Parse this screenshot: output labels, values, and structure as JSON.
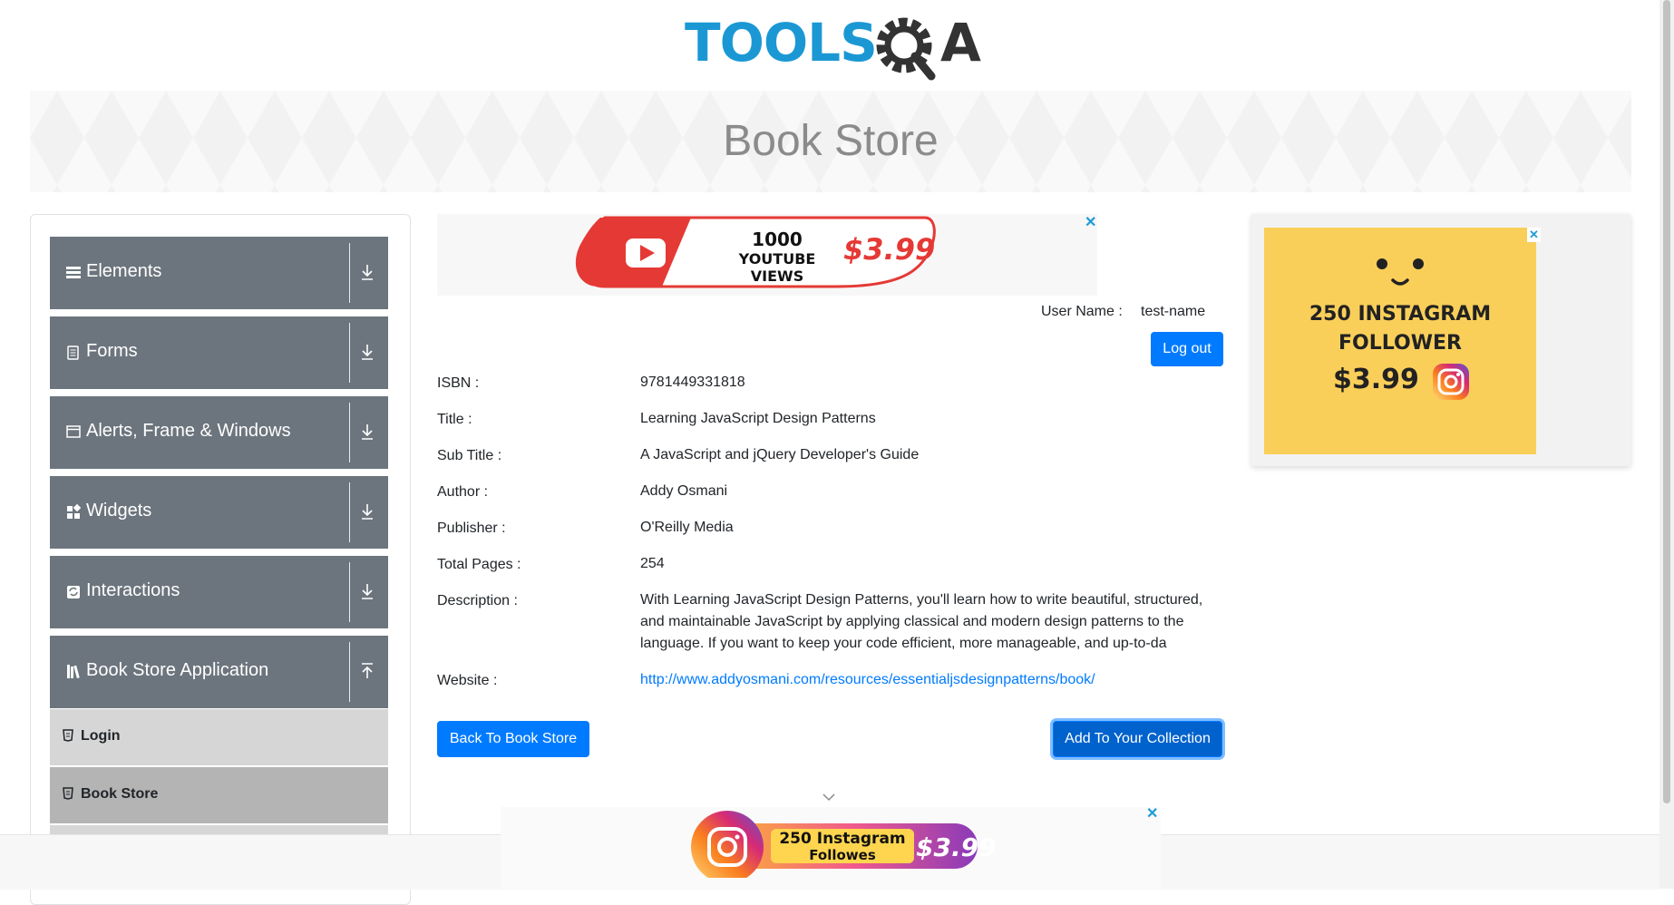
{
  "header": {
    "logo_text": "TOOLS",
    "logo_text_end": "A",
    "banner_title": "Book Store"
  },
  "sidebar": {
    "groups": [
      {
        "label": "Elements",
        "icon": "menu-icon"
      },
      {
        "label": "Forms",
        "icon": "document-icon"
      },
      {
        "label": "Alerts, Frame & Windows",
        "icon": "window-icon"
      },
      {
        "label": "Widgets",
        "icon": "widgets-icon"
      },
      {
        "label": "Interactions",
        "icon": "interactions-icon"
      },
      {
        "label": "Book Store Application",
        "icon": "books-icon"
      }
    ],
    "items": [
      {
        "label": "Login"
      },
      {
        "label": "Book Store"
      }
    ]
  },
  "user": {
    "label": "User Name :",
    "value": "test-name",
    "logout": "Log out"
  },
  "book": {
    "isbn_label": "ISBN :",
    "isbn": "9781449331818",
    "title_label": "Title :",
    "title": "Learning JavaScript Design Patterns",
    "subtitle_label": "Sub Title :",
    "subtitle": "A JavaScript and jQuery Developer's Guide",
    "author_label": "Author :",
    "author": "Addy Osmani",
    "publisher_label": "Publisher :",
    "publisher": "O'Reilly Media",
    "pages_label": "Total Pages :",
    "pages": "254",
    "description_label": "Description :",
    "description": "With Learning JavaScript Design Patterns, you'll learn how to write beautiful, structured, and maintainable JavaScript by applying classical and modern design patterns to the language. If you want to keep your code efficient, more manageable, and up-to-da",
    "website_label": "Website :",
    "website": "http://www.addyosmani.com/resources/essentialjsdesignpatterns/book/"
  },
  "actions": {
    "back": "Back To Book Store",
    "add": "Add To Your Collection"
  },
  "ads": {
    "top_line1": "1000",
    "top_line2": "YOUTUBE VIEWS",
    "top_price": "$3.99",
    "right_line1": "250 INSTAGRAM",
    "right_line2": "FOLLOWER",
    "right_price": "$3.99",
    "bottom_line1": "250 Instagram",
    "bottom_line2": "Followes",
    "bottom_price": "$3.99",
    "close": "✕"
  },
  "colors": {
    "accent": "#007bff",
    "sidebar_group": "#6c757d",
    "logo_blue": "#1b98d4"
  }
}
